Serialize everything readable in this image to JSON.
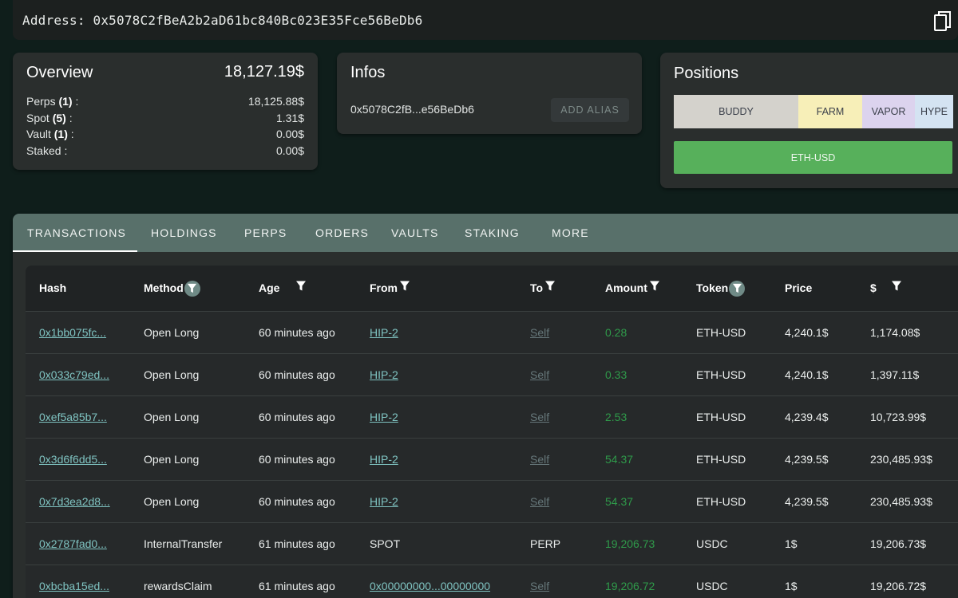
{
  "address_bar": {
    "label": "Address: 0x5078C2fBeA2b2aD61bc840Bc023E35Fce56BeDb6",
    "copy_icon": "copy-icon"
  },
  "overview": {
    "title": "Overview",
    "total": "18,127.19$",
    "rows": [
      {
        "label": "Perps",
        "count": "(1)",
        "suffix": " :",
        "value": "18,125.88$"
      },
      {
        "label": "Spot",
        "count": "(5)",
        "suffix": " :",
        "value": "1.31$"
      },
      {
        "label": "Vault",
        "count": "(1)",
        "suffix": " :",
        "value": "0.00$"
      },
      {
        "label": "Staked",
        "count": "",
        "suffix": " :",
        "value": "0.00$"
      }
    ]
  },
  "infos": {
    "title": "Infos",
    "short_address": "0x5078C2fB...e56BeDb6",
    "add_alias": "ADD ALIAS"
  },
  "positions": {
    "title": "Positions",
    "segments": [
      {
        "label": "BUDDY",
        "color": "#d4d2cc"
      },
      {
        "label": "FARM",
        "color": "#f7efb8"
      },
      {
        "label": "VAPOR",
        "color": "#dcd3ee"
      },
      {
        "label": "HYPE",
        "color": "#d4e3f2"
      }
    ],
    "perp": {
      "label": "ETH-USD",
      "color": "#57b05b"
    }
  },
  "tabs": [
    "TRANSACTIONS",
    "HOLDINGS",
    "PERPS",
    "ORDERS",
    "VAULTS",
    "STAKING",
    "MORE"
  ],
  "active_tab": "TRANSACTIONS",
  "table": {
    "headers": [
      "Hash",
      "Method",
      "Age",
      "From",
      "To",
      "Amount",
      "Token",
      "Price",
      "$"
    ],
    "rows": [
      {
        "hash": "0x1bb075fc...",
        "method": "Open Long",
        "age": "60 minutes ago",
        "from": "HIP-2",
        "to": "Self",
        "amount": "0.28",
        "token": "ETH-USD",
        "price": "4,240.1$",
        "usd": "1,174.08$"
      },
      {
        "hash": "0x033c79ed...",
        "method": "Open Long",
        "age": "60 minutes ago",
        "from": "HIP-2",
        "to": "Self",
        "amount": "0.33",
        "token": "ETH-USD",
        "price": "4,240.1$",
        "usd": "1,397.11$"
      },
      {
        "hash": "0xef5a85b7...",
        "method": "Open Long",
        "age": "60 minutes ago",
        "from": "HIP-2",
        "to": "Self",
        "amount": "2.53",
        "token": "ETH-USD",
        "price": "4,239.4$",
        "usd": "10,723.99$"
      },
      {
        "hash": "0x3d6f6dd5...",
        "method": "Open Long",
        "age": "60 minutes ago",
        "from": "HIP-2",
        "to": "Self",
        "amount": "54.37",
        "token": "ETH-USD",
        "price": "4,239.5$",
        "usd": "230,485.93$"
      },
      {
        "hash": "0x7d3ea2d8...",
        "method": "Open Long",
        "age": "60 minutes ago",
        "from": "HIP-2",
        "to": "Self",
        "amount": "54.37",
        "token": "ETH-USD",
        "price": "4,239.5$",
        "usd": "230,485.93$"
      },
      {
        "hash": "0x2787fad0...",
        "method": "InternalTransfer",
        "age": "61 minutes ago",
        "from": "SPOT",
        "to": "PERP",
        "amount": "19,206.73",
        "token": "USDC",
        "price": "1$",
        "usd": "19,206.73$"
      },
      {
        "hash": "0xbcba15ed...",
        "method": "rewardsClaim",
        "age": "61 minutes ago",
        "from": "0x00000000...00000000",
        "to": "Self",
        "amount": "19,206.72",
        "token": "USDC",
        "price": "1$",
        "usd": "19,206.72$"
      }
    ]
  },
  "colors": {
    "link": "#7fc3c1",
    "amount": "#2f9a4a",
    "self": "#66777a",
    "tabbar": "#58706a"
  }
}
